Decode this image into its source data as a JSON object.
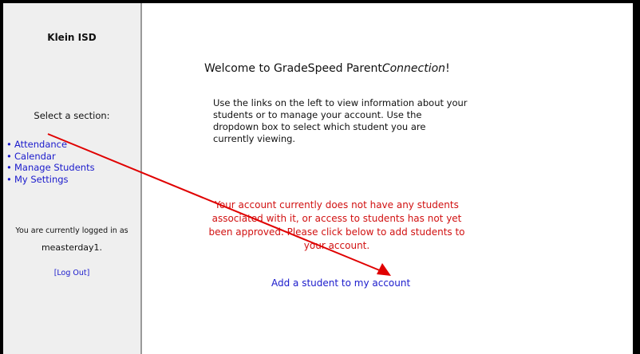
{
  "sidebar": {
    "district": "Klein ISD",
    "select_label": "Select a section:",
    "items": [
      {
        "label": "Attendance"
      },
      {
        "label": "Calendar"
      },
      {
        "label": "Manage Students"
      },
      {
        "label": "My Settings"
      }
    ],
    "logged_in_text": "You are currently logged in as",
    "username": "measterday1.",
    "logout_label": "[Log Out]"
  },
  "main": {
    "welcome_prefix": "Welcome to GradeSpeed Parent",
    "welcome_em": "Connection",
    "welcome_suffix": "!",
    "intro": "Use the links on the left to view information about your students or to manage your account.   Use the dropdown box to select which student you are currently viewing.",
    "alert": "Your account currently does not have any students associated with it, or access to students has not yet been approved. Please click below to add students to your account.",
    "add_link": "Add a student to my account"
  },
  "colors": {
    "link": "#1a1acc",
    "alert": "#d11111",
    "sidebar_bg": "#efefef",
    "annotation_arrow": "#e00000"
  }
}
